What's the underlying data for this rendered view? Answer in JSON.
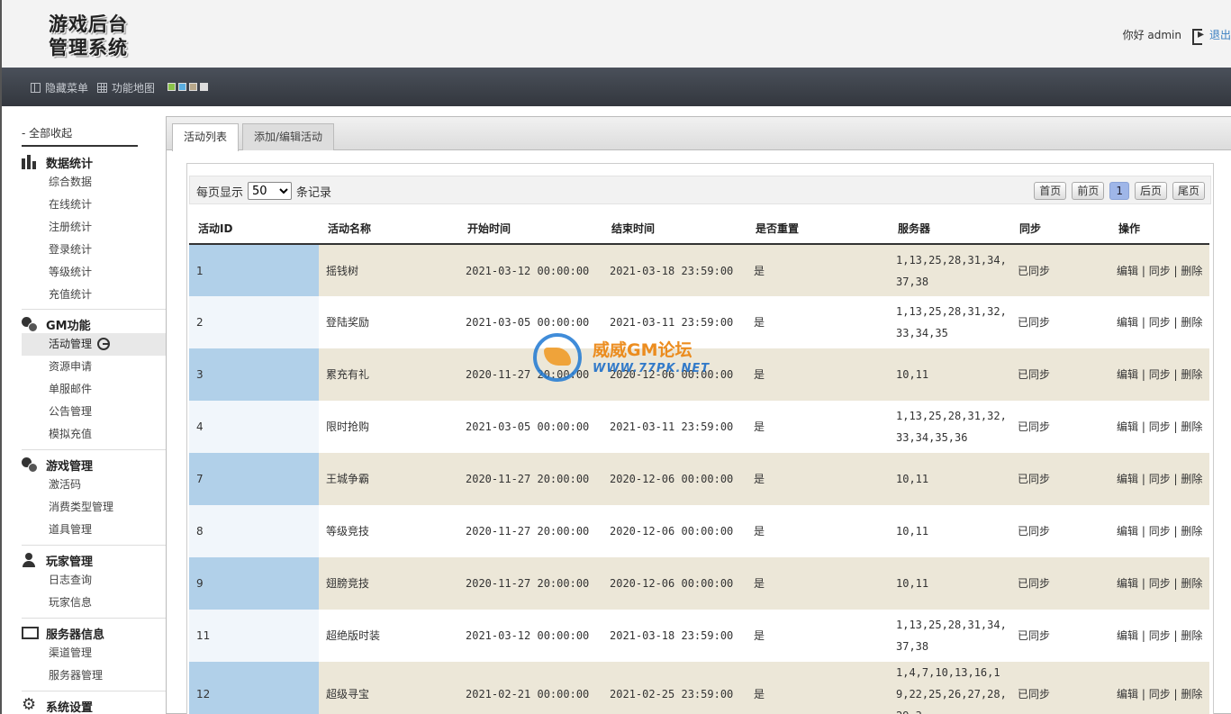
{
  "header": {
    "logo_line1": "游戏后台",
    "logo_line2": "管理系统",
    "greeting": "你好 admin",
    "logout": "退出"
  },
  "toolbar": {
    "hide_menu": "隐藏菜单",
    "function_map": "功能地图",
    "theme_colors": [
      "#8bc34a",
      "#5aaee0",
      "#b8a88a",
      "#dddddd"
    ]
  },
  "sidebar": {
    "collapse_all": "- 全部收起",
    "groups": [
      {
        "title": "数据统计",
        "icon": "bar-chart-icon",
        "items": [
          "综合数据",
          "在线统计",
          "注册统计",
          "登录统计",
          "等级统计",
          "充值统计"
        ]
      },
      {
        "title": "GM功能",
        "icon": "gears-icon",
        "items": [
          "活动管理",
          "资源申请",
          "单服邮件",
          "公告管理",
          "模拟充值"
        ]
      },
      {
        "title": "游戏管理",
        "icon": "gears-icon",
        "items": [
          "激活码",
          "消费类型管理",
          "道具管理"
        ]
      },
      {
        "title": "玩家管理",
        "icon": "user-icon",
        "items": [
          "日志查询",
          "玩家信息"
        ]
      },
      {
        "title": "服务器信息",
        "icon": "monitor-icon",
        "items": [
          "渠道管理",
          "服务器管理"
        ]
      },
      {
        "title": "系统设置",
        "icon": "cog-icon",
        "items": []
      }
    ],
    "active_item": "活动管理"
  },
  "tabs": [
    {
      "label": "活动列表",
      "active": true
    },
    {
      "label": "添加/编辑活动",
      "active": false
    }
  ],
  "list": {
    "per_page_prefix": "每页显示",
    "per_page_value": "50",
    "per_page_suffix": "条记录",
    "pager": {
      "first": "首页",
      "prev": "前页",
      "current": "1",
      "next": "后页",
      "last": "尾页"
    },
    "columns": [
      "活动ID",
      "活动名称",
      "开始时间",
      "结束时间",
      "是否重置",
      "服务器",
      "同步",
      "操作"
    ],
    "rows": [
      {
        "id": "1",
        "name": "摇钱树",
        "start": "2021-03-12 00:00:00",
        "end": "2021-03-18 23:59:00",
        "reset": "是",
        "servers": "1,13,25,28,31,34,37,38",
        "sync": "已同步"
      },
      {
        "id": "2",
        "name": "登陆奖励",
        "start": "2021-03-05 00:00:00",
        "end": "2021-03-11 23:59:00",
        "reset": "是",
        "servers": "1,13,25,28,31,32,33,34,35",
        "sync": "已同步"
      },
      {
        "id": "3",
        "name": "累充有礼",
        "start": "2020-11-27 20:00:00",
        "end": "2020-12-06 00:00:00",
        "reset": "是",
        "servers": "10,11",
        "sync": "已同步"
      },
      {
        "id": "4",
        "name": "限时抢购",
        "start": "2021-03-05 00:00:00",
        "end": "2021-03-11 23:59:00",
        "reset": "是",
        "servers": "1,13,25,28,31,32,33,34,35,36",
        "sync": "已同步"
      },
      {
        "id": "7",
        "name": "王城争霸",
        "start": "2020-11-27 20:00:00",
        "end": "2020-12-06 00:00:00",
        "reset": "是",
        "servers": "10,11",
        "sync": "已同步"
      },
      {
        "id": "8",
        "name": "等级竞技",
        "start": "2020-11-27 20:00:00",
        "end": "2020-12-06 00:00:00",
        "reset": "是",
        "servers": "10,11",
        "sync": "已同步"
      },
      {
        "id": "9",
        "name": "翅膀竞技",
        "start": "2020-11-27 20:00:00",
        "end": "2020-12-06 00:00:00",
        "reset": "是",
        "servers": "10,11",
        "sync": "已同步"
      },
      {
        "id": "11",
        "name": "超绝版时装",
        "start": "2021-03-12 00:00:00",
        "end": "2021-03-18 23:59:00",
        "reset": "是",
        "servers": "1,13,25,28,31,34,37,38",
        "sync": "已同步"
      },
      {
        "id": "12",
        "name": "超级寻宝",
        "start": "2021-02-21 00:00:00",
        "end": "2021-02-25 23:59:00",
        "reset": "是",
        "servers": "1,4,7,10,13,16,19,22,25,26,27,28,29,3",
        "sync": "已同步"
      }
    ],
    "actions": {
      "edit": "编辑",
      "sync": "同步",
      "delete": "删除"
    }
  },
  "watermark": {
    "line1": "威威GM论坛",
    "line2": "WWW.77PK.NET"
  }
}
